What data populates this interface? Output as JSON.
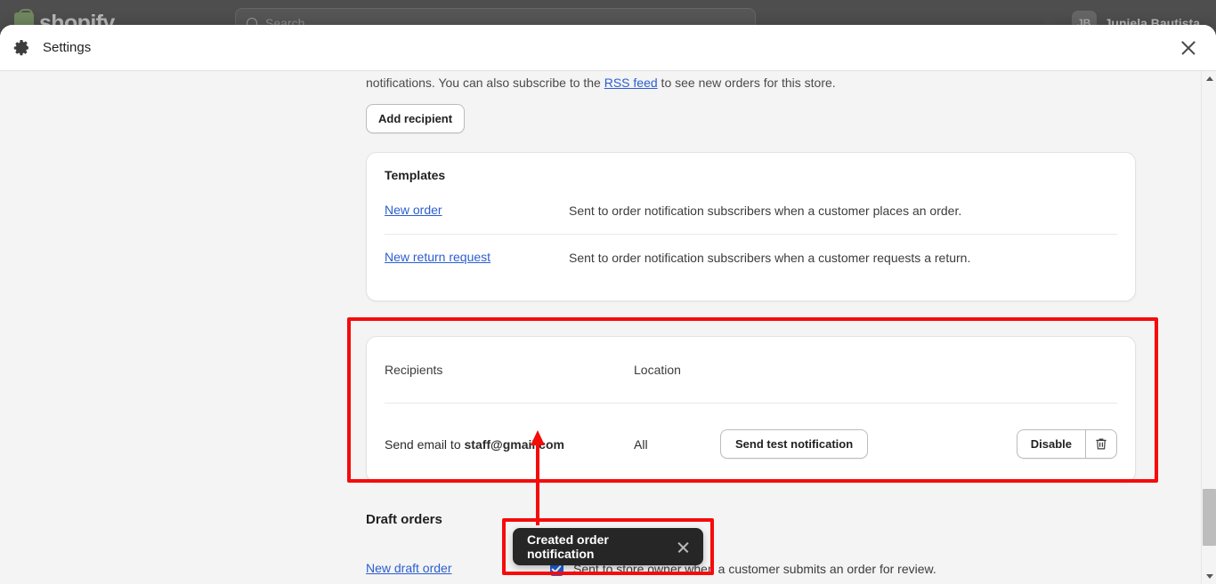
{
  "admin": {
    "brand": "shopify",
    "search_placeholder": "Search",
    "user_initials": "JB",
    "user_name": "Juniela Bautista"
  },
  "modal": {
    "title": "Settings",
    "close_label": "✕"
  },
  "intro": {
    "text_before": "notifications. You can also subscribe to the ",
    "link": "RSS feed",
    "text_after": " to see new orders for this store."
  },
  "actions": {
    "add_recipient": "Add recipient",
    "send_test": "Send test notification",
    "disable": "Disable",
    "delete_title": "Delete"
  },
  "templates": {
    "title": "Templates",
    "rows": [
      {
        "name": "New order",
        "desc": "Sent to order notification subscribers when a customer places an order."
      },
      {
        "name": "New return request",
        "desc": "Sent to order notification subscribers when a customer requests a return."
      }
    ]
  },
  "recipients": {
    "col_recipients": "Recipients",
    "col_location": "Location",
    "row": {
      "prefix": "Send email to ",
      "email": "staff@gmail.com",
      "location": "All"
    }
  },
  "draft_orders": {
    "title": "Draft orders",
    "link": "New draft order",
    "checkbox_label": "Sent to store owner when a customer submits an order for review.",
    "checkbox_checked": true
  },
  "toast": {
    "message": "Created order notification"
  },
  "colors": {
    "highlight": "#f60b0b",
    "link": "#2c5ecf",
    "checkbox": "#1a5fd8",
    "toast_bg": "#262626",
    "page_bg": "#f4f4f4"
  }
}
